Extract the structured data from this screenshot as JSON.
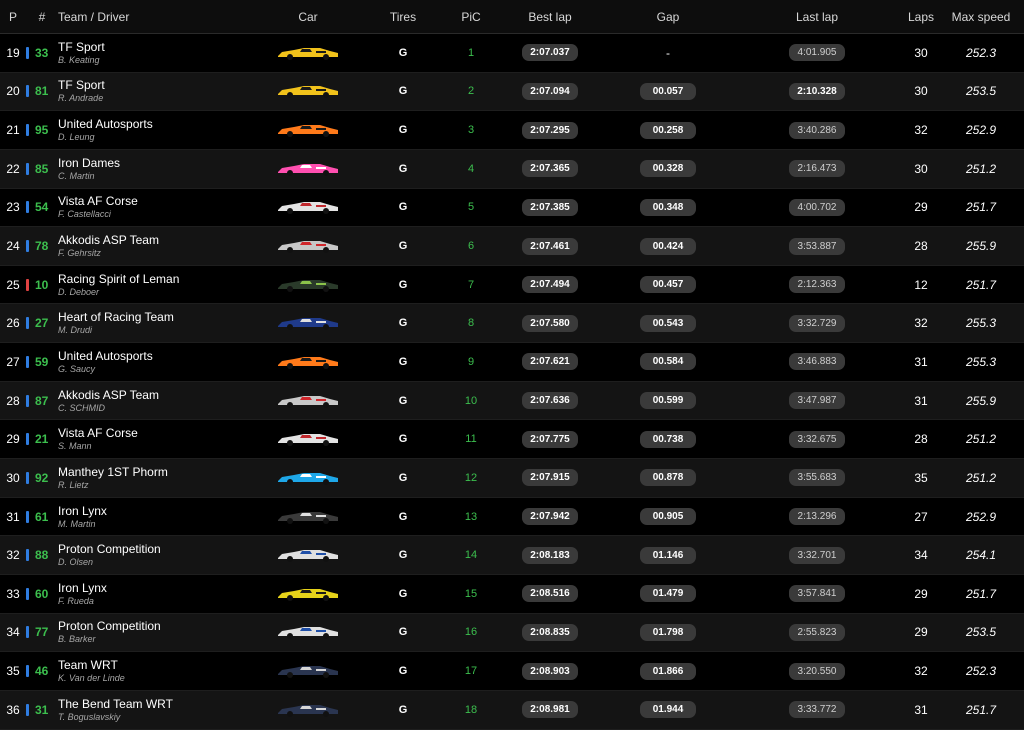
{
  "headers": {
    "pos": "P",
    "num": "#",
    "team": "Team / Driver",
    "car": "Car",
    "tires": "Tires",
    "pic": "PiC",
    "best": "Best lap",
    "gap": "Gap",
    "last": "Last lap",
    "laps": "Laps",
    "speed": "Max speed"
  },
  "colors": {
    "class_green": "#3cbf4e",
    "class_blue": "#2f7de1",
    "class_red": "#e04242"
  },
  "rows": [
    {
      "pos": "19",
      "num": "33",
      "bar": "#2f7de1",
      "team": "TF Sport",
      "driver": "B. Keating",
      "car": "car-image",
      "car_colors": [
        "#f1c21b",
        "#1a1a1a"
      ],
      "tires": "G",
      "pic": "1",
      "best": "2:07.037",
      "gap": "-",
      "last": "4:01.905",
      "last_muted": true,
      "laps": "30",
      "speed": "252.3"
    },
    {
      "pos": "20",
      "num": "81",
      "bar": "#2f7de1",
      "team": "TF Sport",
      "driver": "R. Andrade",
      "car": "car-image",
      "car_colors": [
        "#f1c21b",
        "#1a1a1a"
      ],
      "tires": "G",
      "pic": "2",
      "best": "2:07.094",
      "gap": "00.057",
      "last": "2:10.328",
      "last_muted": false,
      "laps": "30",
      "speed": "253.5"
    },
    {
      "pos": "21",
      "num": "95",
      "bar": "#2f7de1",
      "team": "United Autosports",
      "driver": "D. Leung",
      "car": "car-image",
      "car_colors": [
        "#ff7a1a",
        "#1a1a1a"
      ],
      "tires": "G",
      "pic": "3",
      "best": "2:07.295",
      "gap": "00.258",
      "last": "3:40.286",
      "last_muted": true,
      "laps": "32",
      "speed": "252.9"
    },
    {
      "pos": "22",
      "num": "85",
      "bar": "#2f7de1",
      "team": "Iron Dames",
      "driver": "C. Martin",
      "car": "car-image",
      "car_colors": [
        "#ff4fb0",
        "#ffffff"
      ],
      "tires": "G",
      "pic": "4",
      "best": "2:07.365",
      "gap": "00.328",
      "last": "2:16.473",
      "last_muted": true,
      "laps": "30",
      "speed": "251.2"
    },
    {
      "pos": "23",
      "num": "54",
      "bar": "#2f7de1",
      "team": "Vista AF Corse",
      "driver": "F. Castellacci",
      "car": "car-image",
      "car_colors": [
        "#e3e3e3",
        "#c0282d"
      ],
      "tires": "G",
      "pic": "5",
      "best": "2:07.385",
      "gap": "00.348",
      "last": "4:00.702",
      "last_muted": true,
      "laps": "29",
      "speed": "251.7"
    },
    {
      "pos": "24",
      "num": "78",
      "bar": "#2f7de1",
      "team": "Akkodis ASP Team",
      "driver": "F. Gehrsitz",
      "car": "car-image",
      "car_colors": [
        "#c8c8c8",
        "#d0262b"
      ],
      "tires": "G",
      "pic": "6",
      "best": "2:07.461",
      "gap": "00.424",
      "last": "3:53.887",
      "last_muted": true,
      "laps": "28",
      "speed": "255.9"
    },
    {
      "pos": "25",
      "num": "10",
      "bar": "#e04242",
      "team": "Racing Spirit of Leman",
      "driver": "D. Deboer",
      "car": "car-image",
      "car_colors": [
        "#2a3a2a",
        "#8bc34a"
      ],
      "tires": "G",
      "pic": "7",
      "best": "2:07.494",
      "gap": "00.457",
      "last": "2:12.363",
      "last_muted": true,
      "laps": "12",
      "speed": "251.7"
    },
    {
      "pos": "26",
      "num": "27",
      "bar": "#2f7de1",
      "team": "Heart of Racing Team",
      "driver": "M. Drudi",
      "car": "car-image",
      "car_colors": [
        "#1f3a8a",
        "#e0e0e0"
      ],
      "tires": "G",
      "pic": "8",
      "best": "2:07.580",
      "gap": "00.543",
      "last": "3:32.729",
      "last_muted": true,
      "laps": "32",
      "speed": "255.3"
    },
    {
      "pos": "27",
      "num": "59",
      "bar": "#2f7de1",
      "team": "United Autosports",
      "driver": "G. Saucy",
      "car": "car-image",
      "car_colors": [
        "#ff7a1a",
        "#1a1a1a"
      ],
      "tires": "G",
      "pic": "9",
      "best": "2:07.621",
      "gap": "00.584",
      "last": "3:46.883",
      "last_muted": true,
      "laps": "31",
      "speed": "255.3"
    },
    {
      "pos": "28",
      "num": "87",
      "bar": "#2f7de1",
      "team": "Akkodis ASP Team",
      "driver": "C. SCHMID",
      "car": "car-image",
      "car_colors": [
        "#c8c8c8",
        "#d0262b"
      ],
      "tires": "G",
      "pic": "10",
      "best": "2:07.636",
      "gap": "00.599",
      "last": "3:47.987",
      "last_muted": true,
      "laps": "31",
      "speed": "255.9"
    },
    {
      "pos": "29",
      "num": "21",
      "bar": "#2f7de1",
      "team": "Vista AF Corse",
      "driver": "S. Mann",
      "car": "car-image",
      "car_colors": [
        "#e3e3e3",
        "#c0282d"
      ],
      "tires": "G",
      "pic": "11",
      "best": "2:07.775",
      "gap": "00.738",
      "last": "3:32.675",
      "last_muted": true,
      "laps": "28",
      "speed": "251.2"
    },
    {
      "pos": "30",
      "num": "92",
      "bar": "#2f7de1",
      "team": "Manthey 1ST Phorm",
      "driver": "R. Lietz",
      "car": "car-image",
      "car_colors": [
        "#1ea7e8",
        "#ffffff"
      ],
      "tires": "G",
      "pic": "12",
      "best": "2:07.915",
      "gap": "00.878",
      "last": "3:55.683",
      "last_muted": true,
      "laps": "35",
      "speed": "251.2"
    },
    {
      "pos": "31",
      "num": "61",
      "bar": "#2f7de1",
      "team": "Iron Lynx",
      "driver": "M. Martin",
      "car": "car-image",
      "car_colors": [
        "#3a3a3a",
        "#e0e0e0"
      ],
      "tires": "G",
      "pic": "13",
      "best": "2:07.942",
      "gap": "00.905",
      "last": "2:13.296",
      "last_muted": true,
      "laps": "27",
      "speed": "252.9"
    },
    {
      "pos": "32",
      "num": "88",
      "bar": "#2f7de1",
      "team": "Proton Competition",
      "driver": "D. Olsen",
      "car": "car-image",
      "car_colors": [
        "#e0e0e0",
        "#1f4fa8"
      ],
      "tires": "G",
      "pic": "14",
      "best": "2:08.183",
      "gap": "01.146",
      "last": "3:32.701",
      "last_muted": true,
      "laps": "34",
      "speed": "254.1"
    },
    {
      "pos": "33",
      "num": "60",
      "bar": "#2f7de1",
      "team": "Iron Lynx",
      "driver": "F. Rueda",
      "car": "car-image",
      "car_colors": [
        "#e6d21a",
        "#1a1a1a"
      ],
      "tires": "G",
      "pic": "15",
      "best": "2:08.516",
      "gap": "01.479",
      "last": "3:57.841",
      "last_muted": true,
      "laps": "29",
      "speed": "251.7"
    },
    {
      "pos": "34",
      "num": "77",
      "bar": "#2f7de1",
      "team": "Proton Competition",
      "driver": "B. Barker",
      "car": "car-image",
      "car_colors": [
        "#e0e0e0",
        "#1f4fa8"
      ],
      "tires": "G",
      "pic": "16",
      "best": "2:08.835",
      "gap": "01.798",
      "last": "2:55.823",
      "last_muted": true,
      "laps": "29",
      "speed": "253.5"
    },
    {
      "pos": "35",
      "num": "46",
      "bar": "#2f7de1",
      "team": "Team WRT",
      "driver": "K. Van der Linde",
      "car": "car-image",
      "car_colors": [
        "#2a3550",
        "#d6d6d6"
      ],
      "tires": "G",
      "pic": "17",
      "best": "2:08.903",
      "gap": "01.866",
      "last": "3:20.550",
      "last_muted": true,
      "laps": "32",
      "speed": "252.3"
    },
    {
      "pos": "36",
      "num": "31",
      "bar": "#2f7de1",
      "team": "The Bend Team WRT",
      "driver": "T. Boguslavskiy",
      "car": "car-image",
      "car_colors": [
        "#2a3550",
        "#d6d6d6"
      ],
      "tires": "G",
      "pic": "18",
      "best": "2:08.981",
      "gap": "01.944",
      "last": "3:33.772",
      "last_muted": true,
      "laps": "31",
      "speed": "251.7"
    }
  ]
}
